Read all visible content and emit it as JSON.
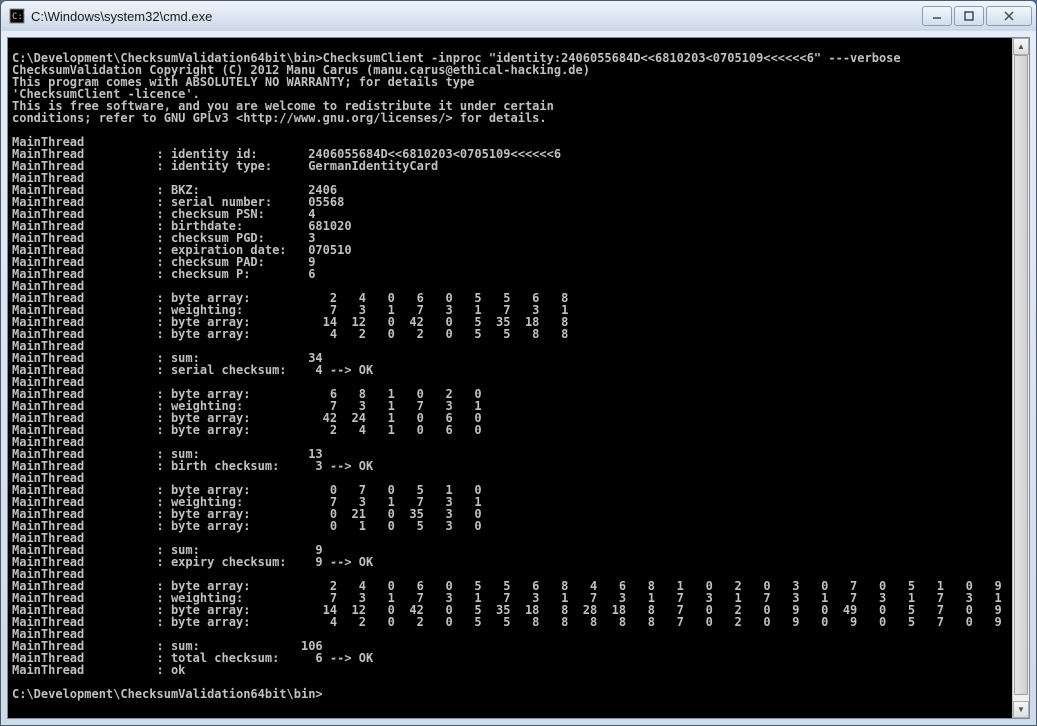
{
  "window": {
    "title": "C:\\Windows\\system32\\cmd.exe"
  },
  "console_lines": [
    "",
    "C:\\Development\\ChecksumValidation64bit\\bin>ChecksumClient -inproc \"identity:2406055684D<<6810203<0705109<<<<<<6\" ---verbose",
    "ChecksumValidation Copyright (C) 2012 Manu Carus (manu.carus@ethical-hacking.de)",
    "This program comes with ABSOLUTELY NO WARRANTY; for details type",
    "'ChecksumClient -licence'.",
    "This is free software, and you are welcome to redistribute it under certain",
    "conditions; refer to GNU GPLv3 <http://www.gnu.org/licenses/> for details.",
    "",
    "MainThread",
    "MainThread          : identity id:       2406055684D<<6810203<0705109<<<<<<6",
    "MainThread          : identity type:     GermanIdentityCard",
    "MainThread",
    "MainThread          : BKZ:               2406",
    "MainThread          : serial number:     05568",
    "MainThread          : checksum PSN:      4",
    "MainThread          : birthdate:         681020",
    "MainThread          : checksum PGD:      3",
    "MainThread          : expiration date:   070510",
    "MainThread          : checksum PAD:      9",
    "MainThread          : checksum P:        6",
    "MainThread",
    "MainThread          : byte array:           2   4   0   6   0   5   5   6   8",
    "MainThread          : weighting:            7   3   1   7   3   1   7   3   1",
    "MainThread          : byte array:          14  12   0  42   0   5  35  18   8",
    "MainThread          : byte array:           4   2   0   2   0   5   5   8   8",
    "MainThread",
    "MainThread          : sum:               34",
    "MainThread          : serial checksum:    4 --> OK",
    "MainThread",
    "MainThread          : byte array:           6   8   1   0   2   0",
    "MainThread          : weighting:            7   3   1   7   3   1",
    "MainThread          : byte array:          42  24   1   0   6   0",
    "MainThread          : byte array:           2   4   1   0   6   0",
    "MainThread",
    "MainThread          : sum:               13",
    "MainThread          : birth checksum:     3 --> OK",
    "MainThread",
    "MainThread          : byte array:           0   7   0   5   1   0",
    "MainThread          : weighting:            7   3   1   7   3   1",
    "MainThread          : byte array:           0  21   0  35   3   0",
    "MainThread          : byte array:           0   1   0   5   3   0",
    "MainThread",
    "MainThread          : sum:                9",
    "MainThread          : expiry checksum:    9 --> OK",
    "MainThread",
    "MainThread          : byte array:           2   4   0   6   0   5   5   6   8   4   6   8   1   0   2   0   3   0   7   0   5   1   0   9",
    "MainThread          : weighting:            7   3   1   7   3   1   7   3   1   7   3   1   7   3   1   7   3   1   7   3   1   7   3   1",
    "MainThread          : byte array:          14  12   0  42   0   5  35  18   8  28  18   8   7   0   2   0   9   0  49   0   5   7   0   9",
    "MainThread          : byte array:           4   2   0   2   0   5   5   8   8   8   8   8   7   0   2   0   9   0   9   0   5   7   0   9",
    "MainThread",
    "MainThread          : sum:              106",
    "MainThread          : total checksum:     6 --> OK",
    "MainThread          : ok",
    "",
    "C:\\Development\\ChecksumValidation64bit\\bin>"
  ]
}
